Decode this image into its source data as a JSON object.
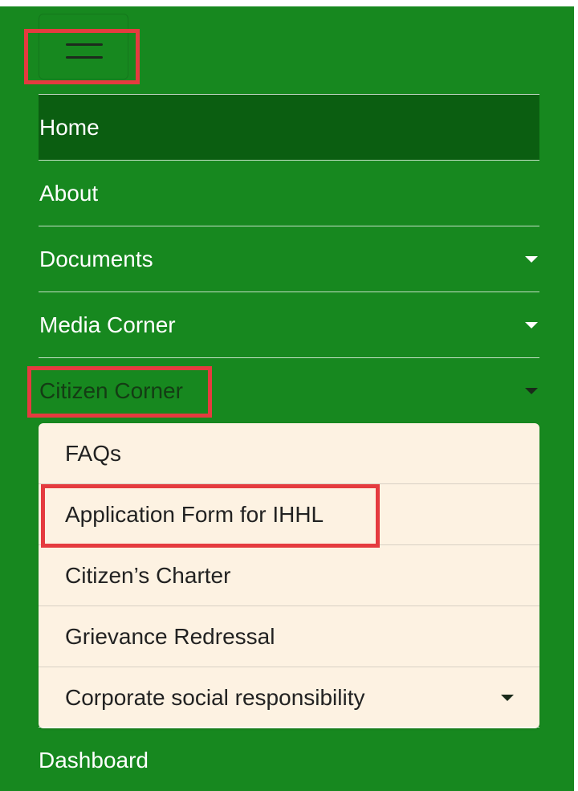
{
  "nav": {
    "items": [
      {
        "label": "Home",
        "active": true,
        "has_dropdown": false
      },
      {
        "label": "About",
        "has_dropdown": false
      },
      {
        "label": "Documents",
        "has_dropdown": true
      },
      {
        "label": "Media Corner",
        "has_dropdown": true
      },
      {
        "label": "Citizen Corner",
        "has_dropdown": true,
        "expanded": true
      }
    ],
    "submenu": [
      {
        "label": "FAQs"
      },
      {
        "label": "Application Form for IHHL"
      },
      {
        "label": "Citizen’s Charter"
      },
      {
        "label": "Grievance Redressal"
      },
      {
        "label": "Corporate social responsibility",
        "has_dropdown": true
      }
    ],
    "after": {
      "label": "Dashboard"
    }
  },
  "colors": {
    "background": "#17881f",
    "active_item": "#0b5e11",
    "submenu_bg": "#fdf2e2",
    "highlight": "#e53b3f"
  },
  "icons": {
    "menu": "hamburger-menu-icon",
    "dropdown": "caret-down-icon"
  }
}
